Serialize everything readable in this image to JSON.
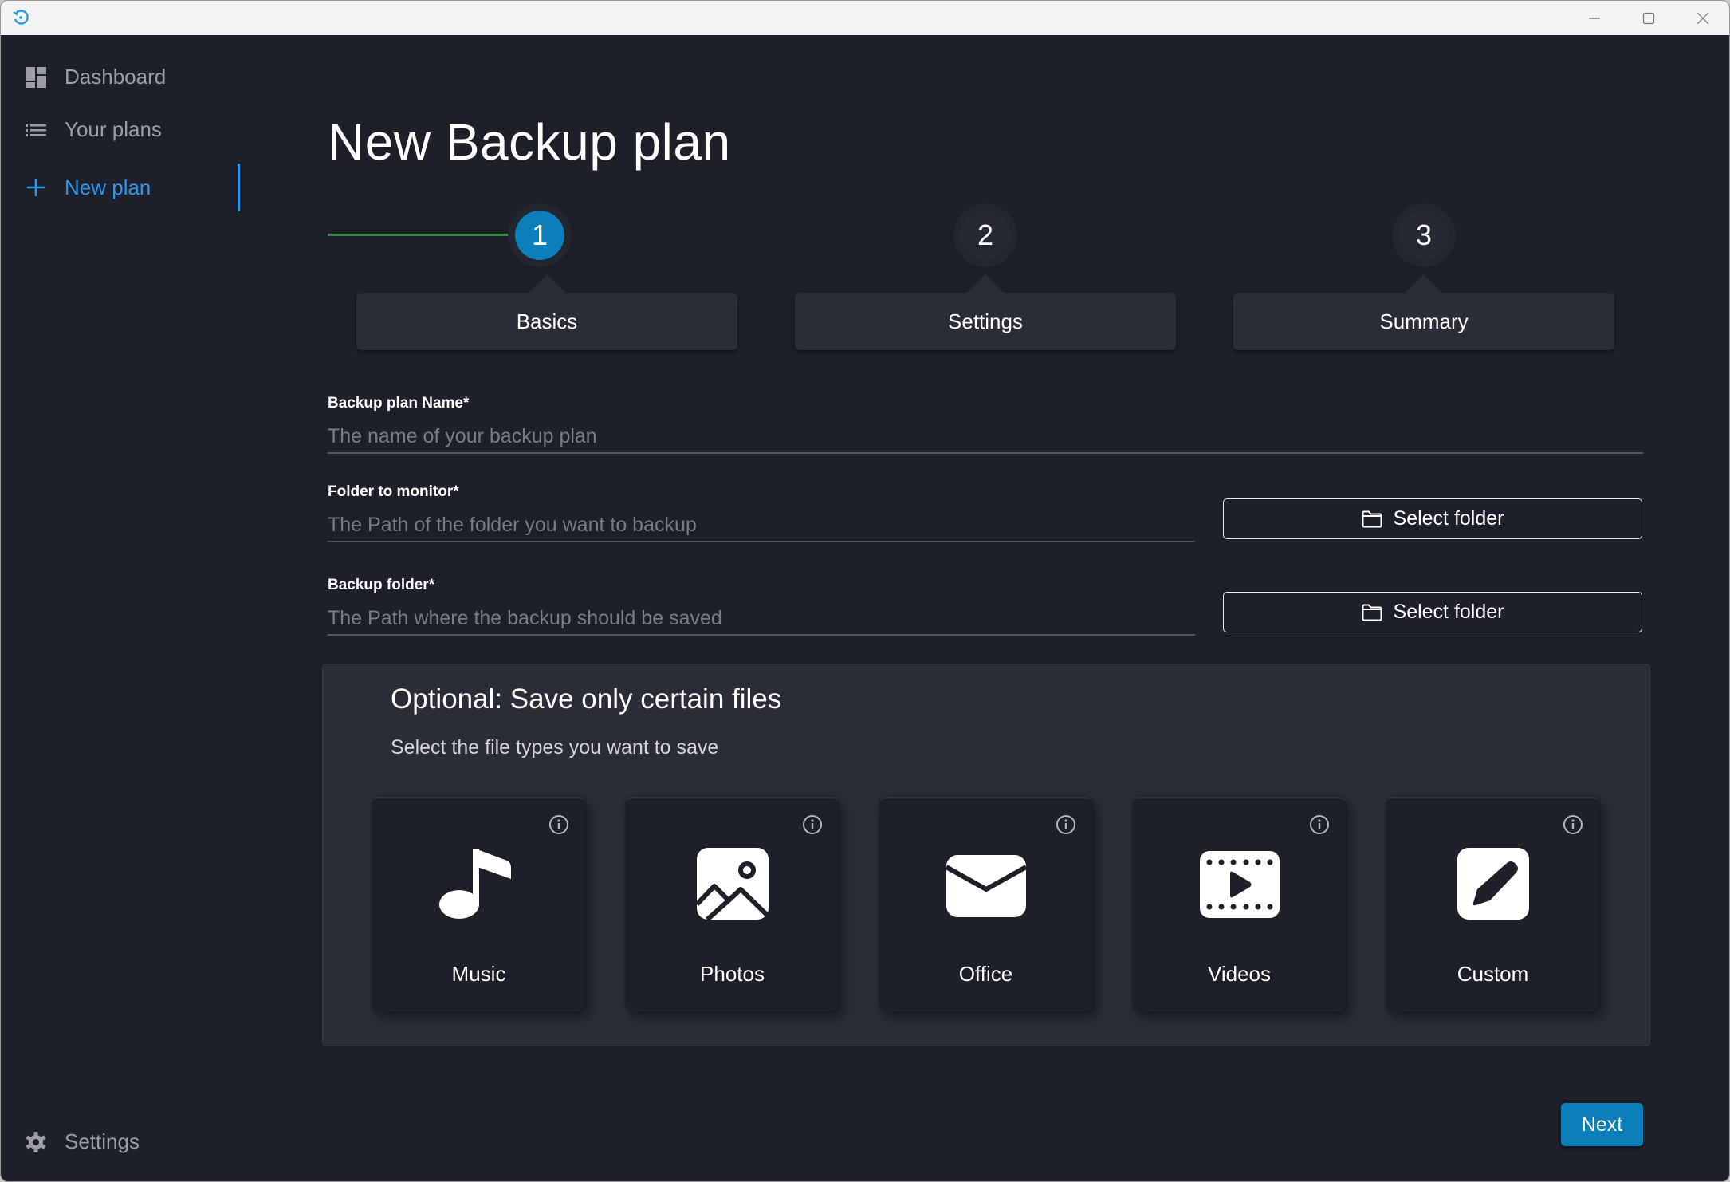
{
  "window": {
    "controls": {
      "minimize": "minimize",
      "maximize": "maximize",
      "close": "close"
    }
  },
  "sidebar": {
    "items": [
      {
        "label": "Dashboard",
        "icon": "dashboard-icon",
        "active": false
      },
      {
        "label": "Your plans",
        "icon": "list-icon",
        "active": false
      },
      {
        "label": "New plan",
        "icon": "plus-icon",
        "active": true
      }
    ],
    "settings_label": "Settings"
  },
  "page": {
    "title": "New Backup plan"
  },
  "stepper": {
    "steps": [
      {
        "number": "1",
        "label": "Basics",
        "current": true
      },
      {
        "number": "2",
        "label": "Settings",
        "current": false
      },
      {
        "number": "3",
        "label": "Summary",
        "current": false
      }
    ]
  },
  "form": {
    "plan_name": {
      "label": "Backup plan Name*",
      "placeholder": "The name of your backup plan",
      "value": ""
    },
    "monitor_folder": {
      "label": "Folder to monitor*",
      "placeholder": "The Path of the folder you want to backup",
      "value": "",
      "button": "Select folder"
    },
    "backup_folder": {
      "label": "Backup folder*",
      "placeholder": "The Path where the backup should be saved",
      "value": "",
      "button": "Select folder"
    }
  },
  "optional": {
    "title": "Optional: Save only certain files",
    "subtitle": "Select the file types you want to save",
    "types": [
      {
        "label": "Music",
        "icon": "music-note-icon"
      },
      {
        "label": "Photos",
        "icon": "image-icon"
      },
      {
        "label": "Office",
        "icon": "envelope-icon"
      },
      {
        "label": "Videos",
        "icon": "video-icon"
      },
      {
        "label": "Custom",
        "icon": "pencil-icon"
      }
    ]
  },
  "footer": {
    "next_label": "Next"
  },
  "colors": {
    "accent": "#0a7fba",
    "nav_active": "#2a98ef",
    "progress": "#2e8a3c",
    "background": "#1d1f29",
    "panel": "#2a2c36"
  }
}
